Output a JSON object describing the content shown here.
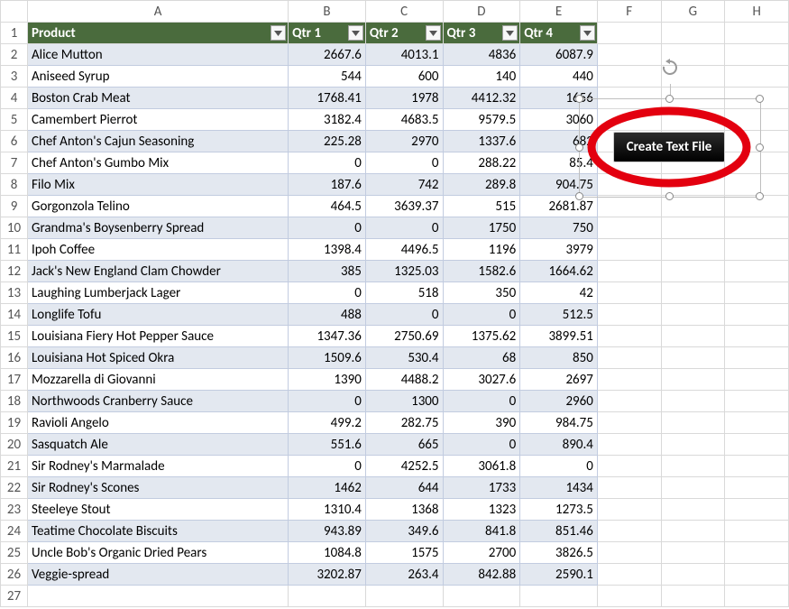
{
  "columns": [
    "A",
    "B",
    "C",
    "D",
    "E",
    "F",
    "G",
    "H"
  ],
  "header": {
    "product": "Product",
    "q1": "Qtr 1",
    "q2": "Qtr 2",
    "q3": "Qtr 3",
    "q4": "Qtr 4"
  },
  "rows": [
    {
      "n": 2,
      "p": "Alice Mutton",
      "q1": "2667.6",
      "q2": "4013.1",
      "q3": "4836",
      "q4": "6087.9"
    },
    {
      "n": 3,
      "p": "Aniseed Syrup",
      "q1": "544",
      "q2": "600",
      "q3": "140",
      "q4": "440"
    },
    {
      "n": 4,
      "p": "Boston Crab Meat",
      "q1": "1768.41",
      "q2": "1978",
      "q3": "4412.32",
      "q4": "1656"
    },
    {
      "n": 5,
      "p": "Camembert Pierrot",
      "q1": "3182.4",
      "q2": "4683.5",
      "q3": "9579.5",
      "q4": "3060"
    },
    {
      "n": 6,
      "p": "Chef Anton's Cajun Seasoning",
      "q1": "225.28",
      "q2": "2970",
      "q3": "1337.6",
      "q4": "682"
    },
    {
      "n": 7,
      "p": "Chef Anton's Gumbo Mix",
      "q1": "0",
      "q2": "0",
      "q3": "288.22",
      "q4": "85.4"
    },
    {
      "n": 8,
      "p": "Filo Mix",
      "q1": "187.6",
      "q2": "742",
      "q3": "289.8",
      "q4": "904.75"
    },
    {
      "n": 9,
      "p": "Gorgonzola Telino",
      "q1": "464.5",
      "q2": "3639.37",
      "q3": "515",
      "q4": "2681.87"
    },
    {
      "n": 10,
      "p": "Grandma's Boysenberry Spread",
      "q1": "0",
      "q2": "0",
      "q3": "1750",
      "q4": "750"
    },
    {
      "n": 11,
      "p": "Ipoh Coffee",
      "q1": "1398.4",
      "q2": "4496.5",
      "q3": "1196",
      "q4": "3979"
    },
    {
      "n": 12,
      "p": "Jack's New England Clam Chowder",
      "q1": "385",
      "q2": "1325.03",
      "q3": "1582.6",
      "q4": "1664.62"
    },
    {
      "n": 13,
      "p": "Laughing Lumberjack Lager",
      "q1": "0",
      "q2": "518",
      "q3": "350",
      "q4": "42"
    },
    {
      "n": 14,
      "p": "Longlife Tofu",
      "q1": "488",
      "q2": "0",
      "q3": "0",
      "q4": "512.5"
    },
    {
      "n": 15,
      "p": "Louisiana Fiery Hot Pepper Sauce",
      "q1": "1347.36",
      "q2": "2750.69",
      "q3": "1375.62",
      "q4": "3899.51"
    },
    {
      "n": 16,
      "p": "Louisiana Hot Spiced Okra",
      "q1": "1509.6",
      "q2": "530.4",
      "q3": "68",
      "q4": "850"
    },
    {
      "n": 17,
      "p": "Mozzarella di Giovanni",
      "q1": "1390",
      "q2": "4488.2",
      "q3": "3027.6",
      "q4": "2697"
    },
    {
      "n": 18,
      "p": "Northwoods Cranberry Sauce",
      "q1": "0",
      "q2": "1300",
      "q3": "0",
      "q4": "2960"
    },
    {
      "n": 19,
      "p": "Ravioli Angelo",
      "q1": "499.2",
      "q2": "282.75",
      "q3": "390",
      "q4": "984.75"
    },
    {
      "n": 20,
      "p": "Sasquatch Ale",
      "q1": "551.6",
      "q2": "665",
      "q3": "0",
      "q4": "890.4"
    },
    {
      "n": 21,
      "p": "Sir Rodney's Marmalade",
      "q1": "0",
      "q2": "4252.5",
      "q3": "3061.8",
      "q4": "0"
    },
    {
      "n": 22,
      "p": "Sir Rodney's Scones",
      "q1": "1462",
      "q2": "644",
      "q3": "1733",
      "q4": "1434"
    },
    {
      "n": 23,
      "p": "Steeleye Stout",
      "q1": "1310.4",
      "q2": "1368",
      "q3": "1323",
      "q4": "1273.5"
    },
    {
      "n": 24,
      "p": "Teatime Chocolate Biscuits",
      "q1": "943.89",
      "q2": "349.6",
      "q3": "841.8",
      "q4": "851.46"
    },
    {
      "n": 25,
      "p": "Uncle Bob's Organic Dried Pears",
      "q1": "1084.8",
      "q2": "1575",
      "q3": "2700",
      "q4": "3826.5"
    },
    {
      "n": 26,
      "p": "Veggie-spread",
      "q1": "3202.87",
      "q2": "263.4",
      "q3": "842.88",
      "q4": "2590.1"
    }
  ],
  "empty_row": 27,
  "button_label": "Create Text File",
  "colors": {
    "header_bg": "#4a6b3d",
    "band_bg": "#e3e8f0",
    "oval_stroke": "#e3000f"
  }
}
